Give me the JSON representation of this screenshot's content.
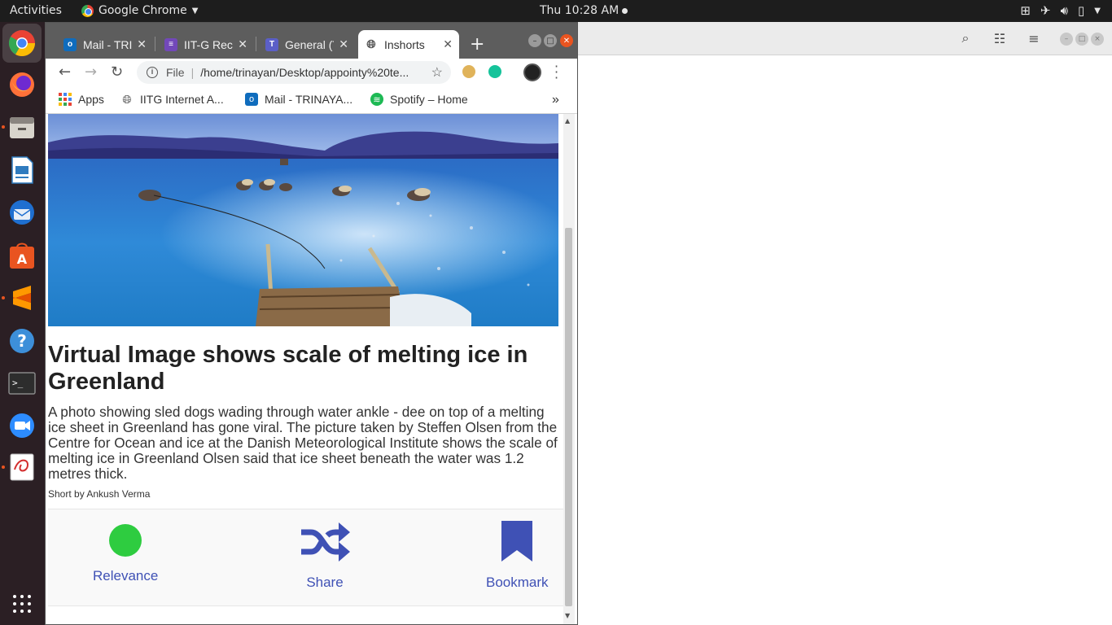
{
  "topbar": {
    "activities": "Activities",
    "app_name": "Google Chrome",
    "clock": "Thu 10:28 AM"
  },
  "dock": {
    "items": [
      "chrome-icon",
      "firefox-icon",
      "files-icon",
      "writer-icon",
      "thunderbird-icon",
      "software-center-icon",
      "sublime-icon",
      "help-icon",
      "terminal-icon",
      "zoom-icon",
      "document-viewer-icon",
      "app-grid-icon"
    ]
  },
  "chrome": {
    "tabs": [
      {
        "title": "Mail - TRINAYAN",
        "icon": "outlook-icon",
        "color": "#0f6cbd"
      },
      {
        "title": "IIT-G Recruitment",
        "icon": "forms-icon",
        "color": "#7248b9"
      },
      {
        "title": "General (Teams)",
        "icon": "teams-icon",
        "color": "#5b5fc7"
      },
      {
        "title": "Inshorts",
        "icon": "globe-icon",
        "color": "#555555"
      }
    ],
    "address": {
      "scheme": "File",
      "url": "/home/trinayan/Desktop/appointy%20te..."
    },
    "bookmarks": [
      {
        "label": "Apps",
        "icon": "apps-grid-icon"
      },
      {
        "label": "IITG Internet A...",
        "icon": "globe-icon"
      },
      {
        "label": "Mail - TRINAYA...",
        "icon": "outlook-icon"
      },
      {
        "label": "Spotify – Home",
        "icon": "spotify-icon"
      }
    ],
    "more_bookmarks": "»"
  },
  "article": {
    "headline": "Virtual Image shows scale of melting ice in Greenland",
    "body": "A photo showing sled dogs wading through water ankle - dee on top of a melting ice sheet in Greenland has gone viral. The picture taken by Steffen Olsen from the Centre for Ocean and ice at the Danish Meteorological Institute shows the scale of melting ice in Greenland Olsen said that ice sheet beneath the water was 1.2 metres thick.",
    "byline": "Short by Ankush Verma"
  },
  "actions": {
    "relevance": "Relevance",
    "share": "Share",
    "bookmark": "Bookmark",
    "accent": "#3f51b5",
    "relevance_color": "#2ecc40"
  }
}
